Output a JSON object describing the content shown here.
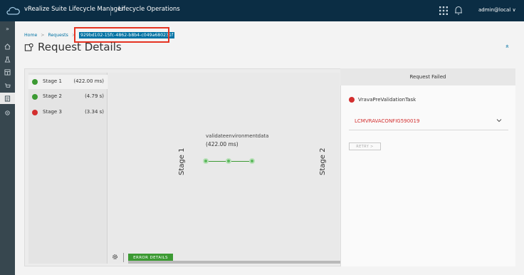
{
  "header": {
    "app_title": "vRealize Suite Lifecycle Manager",
    "section": "Lifecycle Operations",
    "user": "admin@local ∨"
  },
  "rail": {
    "collapse": "»",
    "items": [
      "home-icon",
      "flask-icon",
      "dashboard-icon",
      "cart-icon",
      "list-icon",
      "settings-icon"
    ]
  },
  "breadcrumb": {
    "home": "Home",
    "requests": "Requests",
    "sep": ">",
    "request_id": "929bd102-15fc-4862-b8b4-c049a680231f"
  },
  "page": {
    "title": "Request Details",
    "collapse": "»"
  },
  "stages": [
    {
      "name": "Stage 1",
      "time": "(422.00 ms)",
      "status": "success"
    },
    {
      "name": "Stage 2",
      "time": "(4.79 s)",
      "status": "success"
    },
    {
      "name": "Stage 3",
      "time": "(3.34 s)",
      "status": "error"
    }
  ],
  "canvas": {
    "left_stage": "Stage 1",
    "right_stage": "Stage 2",
    "node_name": "validateenvironmentdata",
    "node_time": "(422.00 ms)",
    "error_button": "ERROR DETAILS"
  },
  "detail": {
    "heading": "Request Failed",
    "task": "VravaPreValidationTask",
    "error_code": "LCMVRAVACONFIG590019",
    "retry": "RETRY >"
  },
  "colors": {
    "header_bg": "#0b2d44",
    "success": "#3c9a33",
    "error": "#d32f2f",
    "link": "#0072a3",
    "highlight": "#e53322"
  }
}
